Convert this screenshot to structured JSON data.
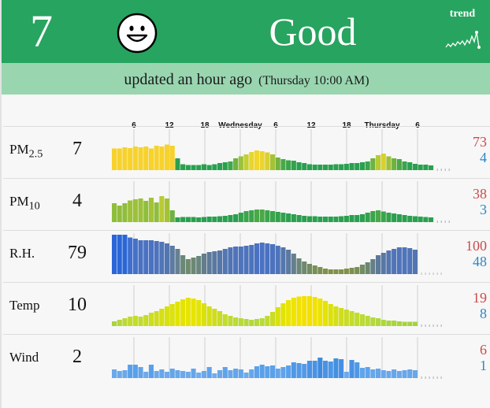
{
  "header": {
    "aqi_value": "7",
    "status": "Good",
    "trend_label": "trend",
    "face_icon": "smiley-face-icon",
    "trend_icon": "sparkline-trend-icon",
    "bar_color": "#27a45f"
  },
  "update": {
    "relative": "updated an hour ago",
    "absolute": "(Thursday 10:00 AM)"
  },
  "time_axis": {
    "labels": [
      {
        "text": "6",
        "hour": 6
      },
      {
        "text": "12",
        "hour": 12
      },
      {
        "text": "18",
        "hour": 18
      },
      {
        "text": "Wednesday",
        "hour": 24
      },
      {
        "text": "6",
        "hour": 30
      },
      {
        "text": "12",
        "hour": 36
      },
      {
        "text": "18",
        "hour": 42
      },
      {
        "text": "Thursday",
        "hour": 48
      },
      {
        "text": "6",
        "hour": 54
      }
    ]
  },
  "metrics": [
    {
      "name_html": "PM<sub>2.5</sub>",
      "name_plain": "PM2.5",
      "value": "7",
      "max": "73",
      "min": "4",
      "readings": [
        55,
        55,
        58,
        56,
        60,
        58,
        60,
        55,
        62,
        60,
        65,
        62,
        30,
        15,
        13,
        13,
        13,
        15,
        13,
        15,
        18,
        20,
        22,
        30,
        35,
        40,
        46,
        50,
        48,
        45,
        40,
        32,
        28,
        25,
        24,
        20,
        18,
        15,
        14,
        14,
        14,
        14,
        15,
        15,
        16,
        18,
        18,
        20,
        22,
        30,
        38,
        42,
        35,
        30,
        28,
        22,
        20,
        16,
        14,
        14,
        12
      ],
      "colors": [
        "#f7d22c",
        "#f7d22c",
        "#f7d22c",
        "#f7d22c",
        "#f7d22c",
        "#f7d22c",
        "#f7d22c",
        "#f7d22c",
        "#f7d22c",
        "#f7d22c",
        "#f7d22c",
        "#f7d22c",
        "#2aa04f",
        "#2aa04f",
        "#2aa04f",
        "#2aa04f",
        "#2aa04f",
        "#2aa04f",
        "#2aa04f",
        "#2aa04f",
        "#2aa04f",
        "#2aa04f",
        "#3fa84a",
        "#6cb43f",
        "#9cc13a",
        "#c4cf33",
        "#e8d52e",
        "#f1d62c",
        "#ecd42d",
        "#d8d030",
        "#a5c236",
        "#72b440",
        "#4ba848",
        "#3aa54b",
        "#33a24c",
        "#2aa04f",
        "#2aa04f",
        "#2aa04f",
        "#2aa04f",
        "#2aa04f",
        "#2aa04f",
        "#2aa04f",
        "#2aa04f",
        "#2aa04f",
        "#2aa04f",
        "#2aa04f",
        "#2aa04f",
        "#2aa04f",
        "#3aa54b",
        "#6cb43f",
        "#b9ca35",
        "#d8d030",
        "#9cc13a",
        "#6cb43f",
        "#4ba848",
        "#3aa54b",
        "#2aa04f",
        "#2aa04f",
        "#2aa04f",
        "#2aa04f",
        "#2aa04f"
      ],
      "end_color": "#aaaaaa"
    },
    {
      "name_html": "PM<sub>10</sub>",
      "name_plain": "PM10",
      "value": "4",
      "max": "38",
      "min": "3",
      "readings": [
        48,
        42,
        48,
        55,
        58,
        60,
        54,
        62,
        50,
        66,
        60,
        30,
        12,
        13,
        13,
        13,
        12,
        13,
        14,
        14,
        15,
        16,
        18,
        20,
        24,
        28,
        30,
        32,
        32,
        30,
        28,
        26,
        24,
        22,
        20,
        18,
        16,
        15,
        15,
        14,
        14,
        14,
        14,
        15,
        16,
        18,
        18,
        20,
        24,
        28,
        30,
        27,
        24,
        22,
        20,
        18,
        16,
        15,
        14,
        13,
        12
      ],
      "colors": [
        "#8fbe3a",
        "#8fbe3a",
        "#8fbe3a",
        "#9cc13a",
        "#9cc13a",
        "#9cc13a",
        "#8fbe3a",
        "#a5c236",
        "#8fbe3a",
        "#b9ca35",
        "#a5c236",
        "#6cb43f",
        "#2aa04f",
        "#2aa04f",
        "#2aa04f",
        "#2aa04f",
        "#2aa04f",
        "#2aa04f",
        "#2aa04f",
        "#2aa04f",
        "#2aa04f",
        "#2aa04f",
        "#2aa04f",
        "#2aa04f",
        "#33a24c",
        "#3aa54b",
        "#3aa54b",
        "#4ba848",
        "#4ba848",
        "#3aa54b",
        "#3aa54b",
        "#33a24c",
        "#33a24c",
        "#2aa04f",
        "#2aa04f",
        "#2aa04f",
        "#2aa04f",
        "#2aa04f",
        "#2aa04f",
        "#2aa04f",
        "#2aa04f",
        "#2aa04f",
        "#2aa04f",
        "#2aa04f",
        "#2aa04f",
        "#2aa04f",
        "#2aa04f",
        "#2aa04f",
        "#33a24c",
        "#3aa54b",
        "#4ba848",
        "#3aa54b",
        "#33a24c",
        "#2aa04f",
        "#2aa04f",
        "#2aa04f",
        "#2aa04f",
        "#2aa04f",
        "#2aa04f",
        "#2aa04f",
        "#2aa04f"
      ],
      "end_color": "#aaaaaa"
    },
    {
      "name_html": "R.H.",
      "name_plain": "R.H.",
      "value": "79",
      "max": "100",
      "min": "48",
      "readings": [
        100,
        100,
        100,
        93,
        90,
        86,
        86,
        86,
        84,
        82,
        78,
        72,
        64,
        48,
        38,
        42,
        46,
        52,
        56,
        58,
        60,
        64,
        68,
        70,
        70,
        72,
        74,
        78,
        80,
        78,
        76,
        72,
        68,
        62,
        52,
        40,
        32,
        26,
        22,
        18,
        14,
        12,
        12,
        12,
        14,
        16,
        18,
        24,
        30,
        38,
        48,
        54,
        60,
        64,
        68,
        68,
        66,
        62
      ],
      "colors": [
        "#2a66d8",
        "#2a66d8",
        "#2a66d8",
        "#3f6fd0",
        "#4670c6",
        "#4a72c2",
        "#4a72c2",
        "#4a72c2",
        "#4d73bd",
        "#5074b8",
        "#5476b0",
        "#5d7aa2",
        "#668090",
        "#6a8779",
        "#6e8b6e",
        "#6c8875",
        "#6a847e",
        "#637d8c",
        "#5d7a98",
        "#5a78a0",
        "#5776a8",
        "#5476b0",
        "#5174b6",
        "#4f74ba",
        "#4f74ba",
        "#4e73bd",
        "#4d73be",
        "#4b72c2",
        "#4a72c4",
        "#4b72c2",
        "#4d73be",
        "#4f74ba",
        "#5476b0",
        "#5c799f",
        "#657f8d",
        "#6a877a",
        "#6e8a6c",
        "#738d61",
        "#788f58",
        "#7c9052",
        "#80914c",
        "#829148",
        "#829148",
        "#829148",
        "#80914c",
        "#7d9050",
        "#7a8f56",
        "#738c62",
        "#6c8770",
        "#657f86",
        "#5c799a",
        "#5877a4",
        "#5476b0",
        "#5174b6",
        "#4f74ba",
        "#4f74ba",
        "#5074b8",
        "#5476b0"
      ],
      "end_color": "#bbbbbb"
    },
    {
      "name_html": "Temp",
      "name_plain": "Temp",
      "value": "10",
      "max": "19",
      "min": "8",
      "readings": [
        12,
        16,
        20,
        24,
        26,
        24,
        28,
        34,
        38,
        44,
        50,
        56,
        62,
        68,
        72,
        70,
        66,
        58,
        50,
        44,
        38,
        30,
        26,
        22,
        20,
        18,
        16,
        18,
        20,
        26,
        36,
        48,
        58,
        66,
        72,
        75,
        76,
        76,
        74,
        70,
        64,
        56,
        50,
        46,
        42,
        38,
        34,
        30,
        26,
        22,
        20,
        16,
        14,
        14,
        12,
        11,
        11,
        11
      ],
      "colors": [
        "#a9d43c",
        "#b6d63c",
        "#bdd935",
        "#c2db2f",
        "#c4dc2b",
        "#c2db2f",
        "#c6dd28",
        "#ccdd22",
        "#d0dd1c",
        "#d4df16",
        "#d8e10f",
        "#dde20a",
        "#e1e306",
        "#e4e303",
        "#e7e402",
        "#e6e402",
        "#e3e305",
        "#dbe10c",
        "#d4df16",
        "#cfdd1d",
        "#c9dc25",
        "#c4dc2b",
        "#bedb34",
        "#badb38",
        "#b8da3a",
        "#b5d93c",
        "#b2d83d",
        "#b5d93c",
        "#b8da3a",
        "#bedb34",
        "#cbdc23",
        "#d8e10f",
        "#e2e305",
        "#e9e400",
        "#efe400",
        "#f2e200",
        "#f4e000",
        "#f4e000",
        "#f2e200",
        "#ece300",
        "#e4e303",
        "#dbe10c",
        "#d4df16",
        "#cfdd1d",
        "#cadc24",
        "#c4dc2b",
        "#c0dc2f",
        "#bcdb34",
        "#b8da3a",
        "#b4d93c",
        "#b2d83d",
        "#aed73d",
        "#aad53d",
        "#aad53d",
        "#a8d43d",
        "#a6d33d",
        "#a6d33d",
        "#a6d33d"
      ],
      "end_color": "#aaaaaa"
    },
    {
      "name_html": "Wind",
      "name_plain": "Wind",
      "value": "2",
      "max": "6",
      "min": "1",
      "readings": [
        22,
        18,
        20,
        34,
        34,
        28,
        16,
        34,
        18,
        22,
        16,
        24,
        20,
        18,
        16,
        24,
        14,
        18,
        28,
        12,
        20,
        28,
        20,
        24,
        22,
        14,
        22,
        30,
        34,
        30,
        32,
        24,
        28,
        32,
        40,
        38,
        36,
        44,
        44,
        52,
        44,
        42,
        50,
        48,
        16,
        46,
        40,
        26,
        28,
        22,
        24,
        20,
        18,
        22,
        18,
        20,
        22,
        20
      ],
      "colors": [
        "#6aa8ea",
        "#6aa8ea",
        "#6aa8ea",
        "#58a0ea",
        "#58a0ea",
        "#62a4ea",
        "#6eaaea",
        "#58a0ea",
        "#6aa8ea",
        "#66a6ea",
        "#6eaaea",
        "#64a5ea",
        "#68a7ea",
        "#6aa8ea",
        "#6eaaea",
        "#64a5ea",
        "#70abea",
        "#6aa8ea",
        "#5fa3ea",
        "#72acea",
        "#68a7ea",
        "#5fa3ea",
        "#68a7ea",
        "#64a5ea",
        "#66a6ea",
        "#70abea",
        "#66a6ea",
        "#5ca1ea",
        "#58a0ea",
        "#5ca1ea",
        "#5aa0ea",
        "#64a5ea",
        "#5fa3ea",
        "#5aa0ea",
        "#4f98e6",
        "#5199e6",
        "#5399e8",
        "#4a93e4",
        "#4a93e4",
        "#3f8ae0",
        "#4a93e4",
        "#4c96e6",
        "#4290e2",
        "#4590e3",
        "#6eaaea",
        "#4792e4",
        "#4f98e6",
        "#62a4ea",
        "#5fa3ea",
        "#66a6ea",
        "#64a5ea",
        "#68a7ea",
        "#6aa8ea",
        "#66a6ea",
        "#6aa8ea",
        "#68a7ea",
        "#66a6ea",
        "#68a7ea"
      ],
      "end_color": "#aaaaaa"
    }
  ]
}
